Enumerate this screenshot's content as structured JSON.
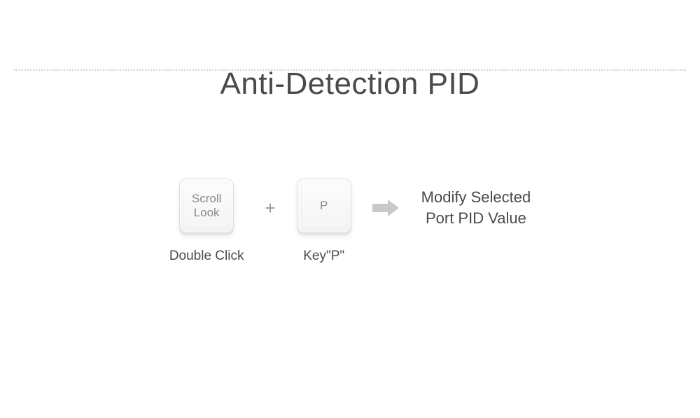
{
  "title": "Anti-Detection PID",
  "key1": {
    "label": "Scroll\nLook",
    "caption": "Double Click"
  },
  "plus": "+",
  "key2": {
    "label": "P",
    "caption": "Key\"P\""
  },
  "result": "Modify Selected\nPort PID Value"
}
